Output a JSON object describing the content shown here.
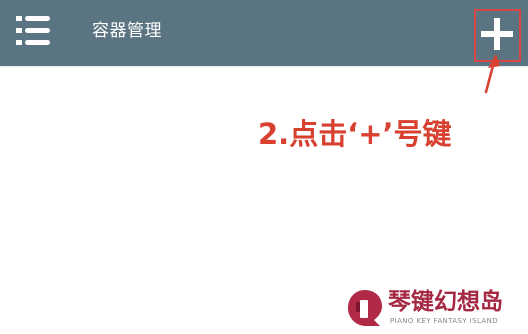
{
  "header": {
    "title": "容器管理",
    "background_color": "#5a7482",
    "menu_icon": "hamburger-list-icon",
    "add_icon": "plus-icon"
  },
  "annotation": {
    "text": "2.点击‘+’号键",
    "color": "#d84030",
    "highlight_color": "#d84646"
  },
  "watermark": {
    "title": "琴键幻想岛",
    "subtitle": "PIANO KEY FANTASY ISLAND",
    "color": "#a52843"
  }
}
